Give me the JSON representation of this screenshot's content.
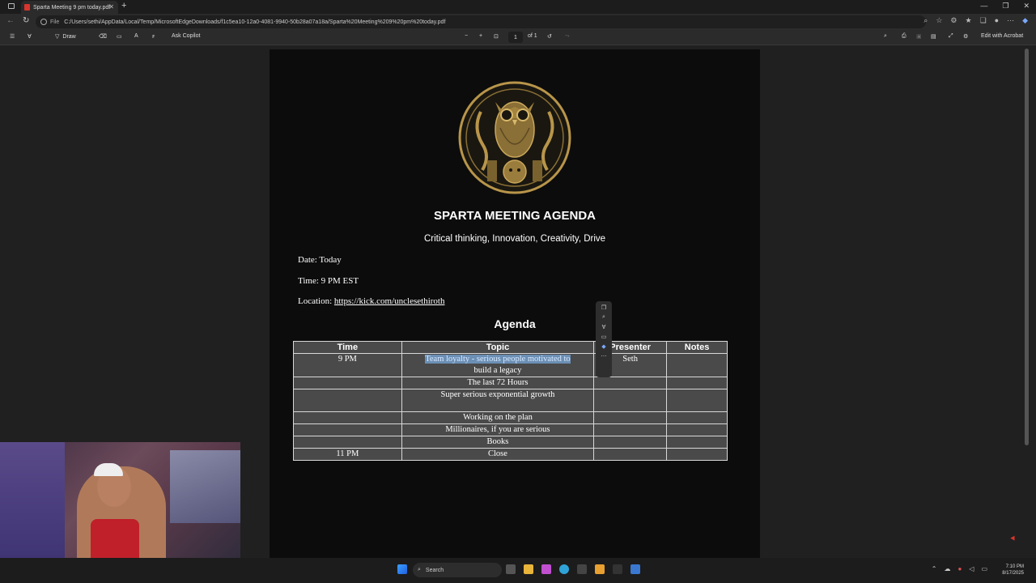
{
  "browser": {
    "tab_title": "Sparta Meeting 9 pm today.pdf",
    "address_prefix": "File",
    "url": "C:/Users/sethi/AppData/Local/Temp/MicrosoftEdgeDownloads/f1c5ea10-12a0-4081-9940-50b28a07a18a/Sparta%20Meeting%209%20pm%20today.pdf"
  },
  "pdf_toolbar": {
    "draw_label": "Draw",
    "copilot_label": "Ask Copilot",
    "page_current": "1",
    "page_total": "of 1",
    "edit_acrobat": "Edit with Acrobat"
  },
  "document": {
    "title": "SPARTA MEETING AGENDA",
    "subtitle": "Critical thinking, Innovation, Creativity, Drive",
    "date_line": "Date: Today",
    "time_line": "Time: 9 PM EST",
    "location_label": "Location: ",
    "location_link": "https://kick.com/unclesethiroth",
    "agenda_heading": "Agenda",
    "table": {
      "headers": [
        "Time",
        "Topic",
        "Presenter",
        "Notes"
      ],
      "rows": [
        {
          "time": "9 PM",
          "topic": "Team loyalty - serious people motivated to",
          "topic2": "build a legacy",
          "presenter": "Seth",
          "notes": ""
        },
        {
          "time": "",
          "topic": "The last 72 Hours",
          "presenter": "",
          "notes": ""
        },
        {
          "time": "",
          "topic": "Super serious exponential growth",
          "presenter": "",
          "notes": ""
        },
        {
          "time": "",
          "topic": "Working on the plan",
          "presenter": "",
          "notes": ""
        },
        {
          "time": "",
          "topic": "Millionaires, if you are serious",
          "presenter": "",
          "notes": ""
        },
        {
          "time": "",
          "topic": "Books",
          "presenter": "",
          "notes": ""
        },
        {
          "time": "11 PM",
          "topic": "Close",
          "presenter": "",
          "notes": ""
        }
      ]
    }
  },
  "taskbar": {
    "search_label": "Search",
    "time": "7:10 PM",
    "date": "8/17/2025"
  },
  "colors": {
    "selection": "#6b8fb4",
    "logo_gold": "#b8954a",
    "table_bg": "#4a4a4a"
  }
}
